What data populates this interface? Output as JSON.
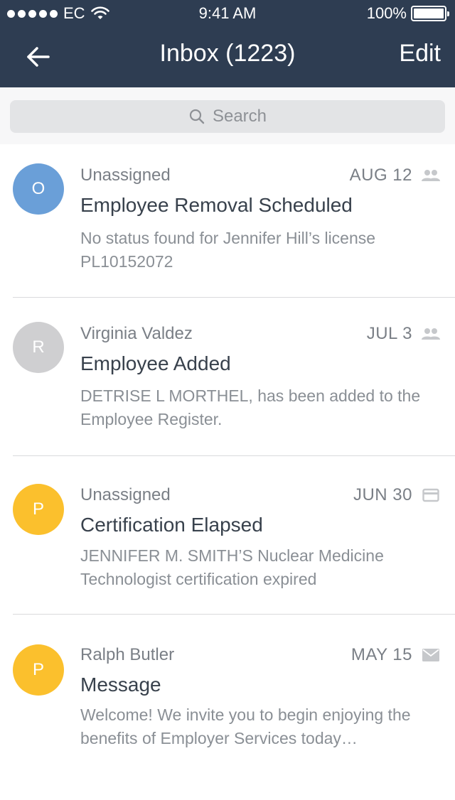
{
  "status_bar": {
    "carrier": "EC",
    "time": "9:41 AM",
    "battery": "100%"
  },
  "nav": {
    "title": "Inbox (1223)",
    "edit_label": "Edit"
  },
  "search": {
    "placeholder": "Search"
  },
  "messages": [
    {
      "avatar_letter": "O",
      "avatar_color": "#6a9fd8",
      "sender": "Unassigned",
      "date": "AUG 12",
      "type_icon": "group-icon",
      "subject": "Employee Removal Scheduled",
      "preview": "No status found for Jennifer Hill’s license PL10152072"
    },
    {
      "avatar_letter": "R",
      "avatar_color": "#cfcfd1",
      "sender": "Virginia Valdez",
      "date": "JUL 3",
      "type_icon": "group-icon",
      "subject": "Employee Added",
      "preview": "DETRISE L MORTHEL, has been added to the Employee Register."
    },
    {
      "avatar_letter": "P",
      "avatar_color": "#fbc02d",
      "sender": "Unassigned",
      "date": "JUN 30",
      "type_icon": "card-icon",
      "subject": "Certification Elapsed",
      "preview": "JENNIFER M. SMITH’S Nuclear Medicine Technologist certification expired"
    },
    {
      "avatar_letter": "P",
      "avatar_color": "#fbc02d",
      "sender": "Ralph Butler",
      "date": "MAY 15",
      "type_icon": "envelope-icon",
      "subject": "Message",
      "preview": "Welcome! We invite you to begin enjoying the benefits of Employer Services today…"
    }
  ]
}
